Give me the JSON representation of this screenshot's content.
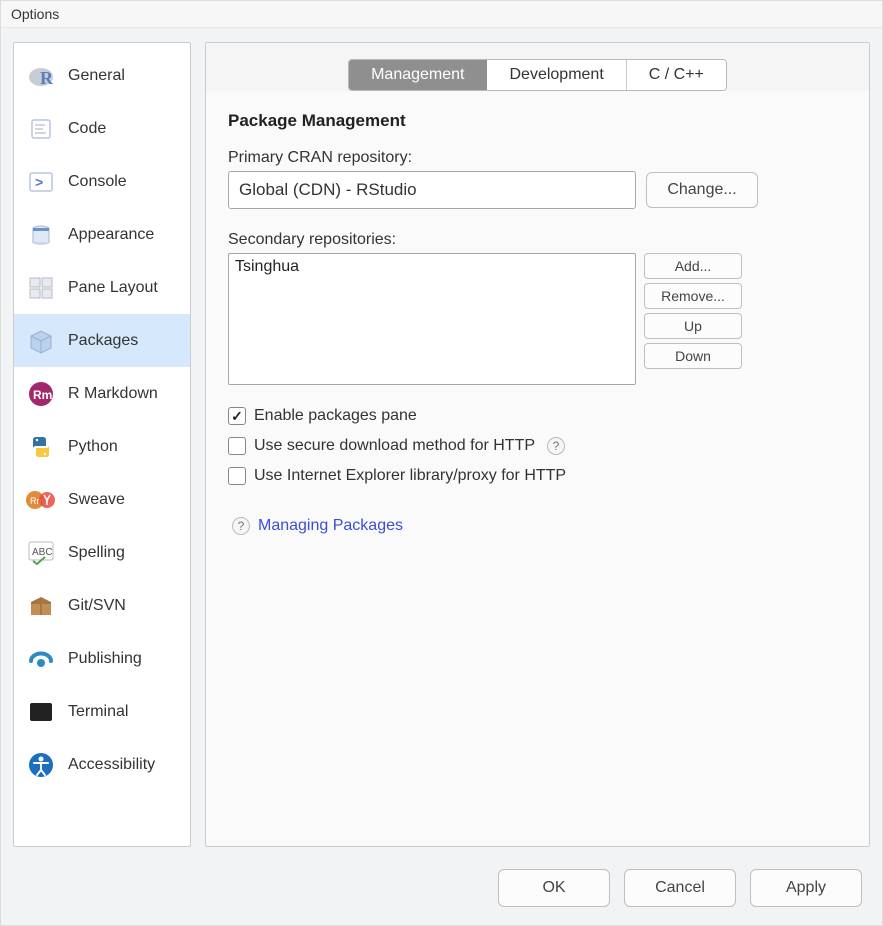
{
  "window": {
    "title": "Options"
  },
  "sidebar": {
    "items": [
      {
        "label": "General"
      },
      {
        "label": "Code"
      },
      {
        "label": "Console"
      },
      {
        "label": "Appearance"
      },
      {
        "label": "Pane Layout"
      },
      {
        "label": "Packages"
      },
      {
        "label": "R Markdown"
      },
      {
        "label": "Python"
      },
      {
        "label": "Sweave"
      },
      {
        "label": "Spelling"
      },
      {
        "label": "Git/SVN"
      },
      {
        "label": "Publishing"
      },
      {
        "label": "Terminal"
      },
      {
        "label": "Accessibility"
      }
    ],
    "selected_index": 5
  },
  "tabs": {
    "items": [
      {
        "label": "Management"
      },
      {
        "label": "Development"
      },
      {
        "label": "C / C++"
      }
    ],
    "active_index": 0
  },
  "panel": {
    "title": "Package Management",
    "primary_label": "Primary CRAN repository:",
    "primary_value": "Global (CDN) - RStudio",
    "change_label": "Change...",
    "secondary_label": "Secondary repositories:",
    "secondary_items": [
      "Tsinghua"
    ],
    "add_label": "Add...",
    "remove_label": "Remove...",
    "up_label": "Up",
    "down_label": "Down",
    "check_enable": "Enable packages pane",
    "check_secure": "Use secure download method for HTTP",
    "check_ie": "Use Internet Explorer library/proxy for HTTP",
    "link_label": "Managing Packages"
  },
  "buttons": {
    "ok": "OK",
    "cancel": "Cancel",
    "apply": "Apply"
  }
}
